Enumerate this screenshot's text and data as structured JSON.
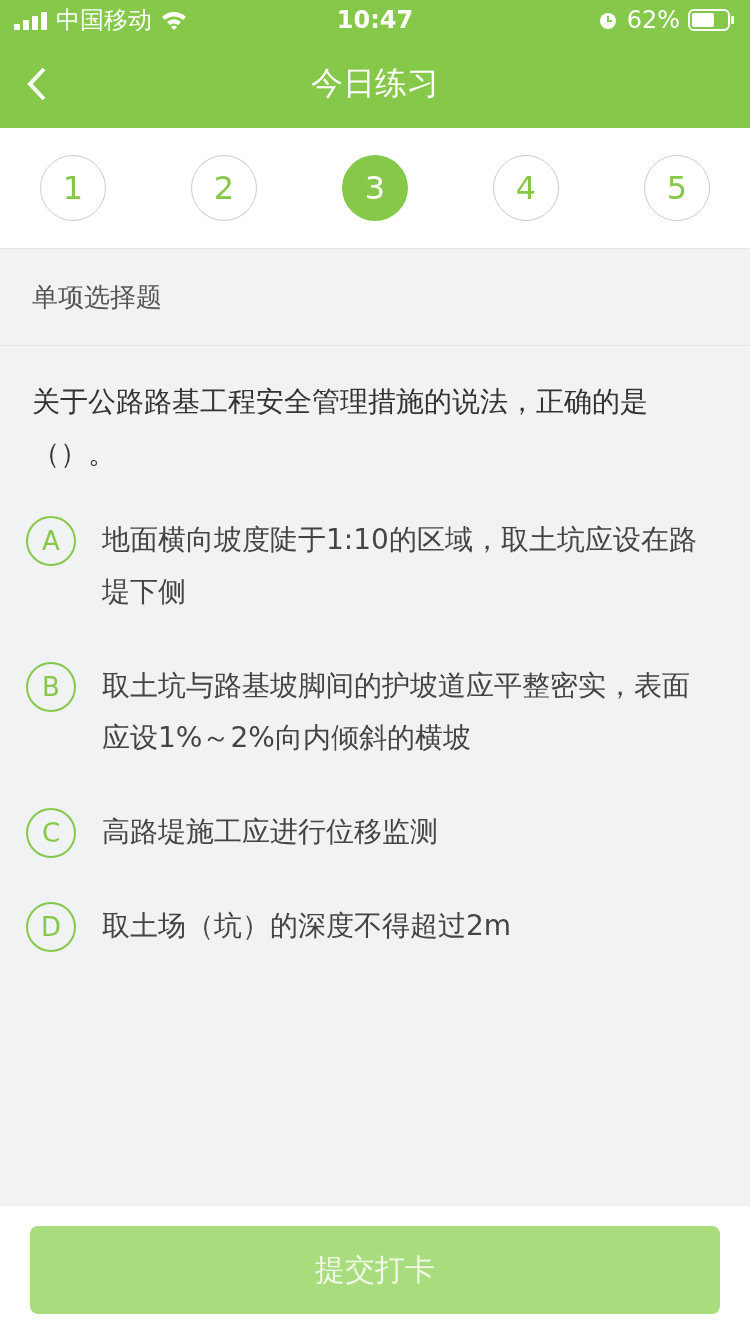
{
  "status_bar": {
    "carrier": "中国移动",
    "time": "10:47",
    "battery": "62%"
  },
  "nav": {
    "title": "今日练习"
  },
  "steps": [
    {
      "label": "1",
      "selected": false
    },
    {
      "label": "2",
      "selected": false
    },
    {
      "label": "3",
      "selected": true
    },
    {
      "label": "4",
      "selected": false
    },
    {
      "label": "5",
      "selected": false
    }
  ],
  "section": "单项选择题",
  "question": "关于公路路基工程安全管理措施的说法，正确的是（）。",
  "options": [
    {
      "letter": "A",
      "text": "地面横向坡度陡于1:10的区域，取土坑应设在路堤下侧",
      "selected": false
    },
    {
      "letter": "B",
      "text": "取土坑与路基坡脚间的护坡道应平整密实，表面应设1%～2%向内倾斜的横坡",
      "selected": false
    },
    {
      "letter": "C",
      "text": "高路堤施工应进行位移监测",
      "selected": false
    },
    {
      "letter": "D",
      "text": "取土场（坑）的深度不得超过2m",
      "selected": false
    }
  ],
  "submit": {
    "label": "提交打卡",
    "disabled": true
  }
}
